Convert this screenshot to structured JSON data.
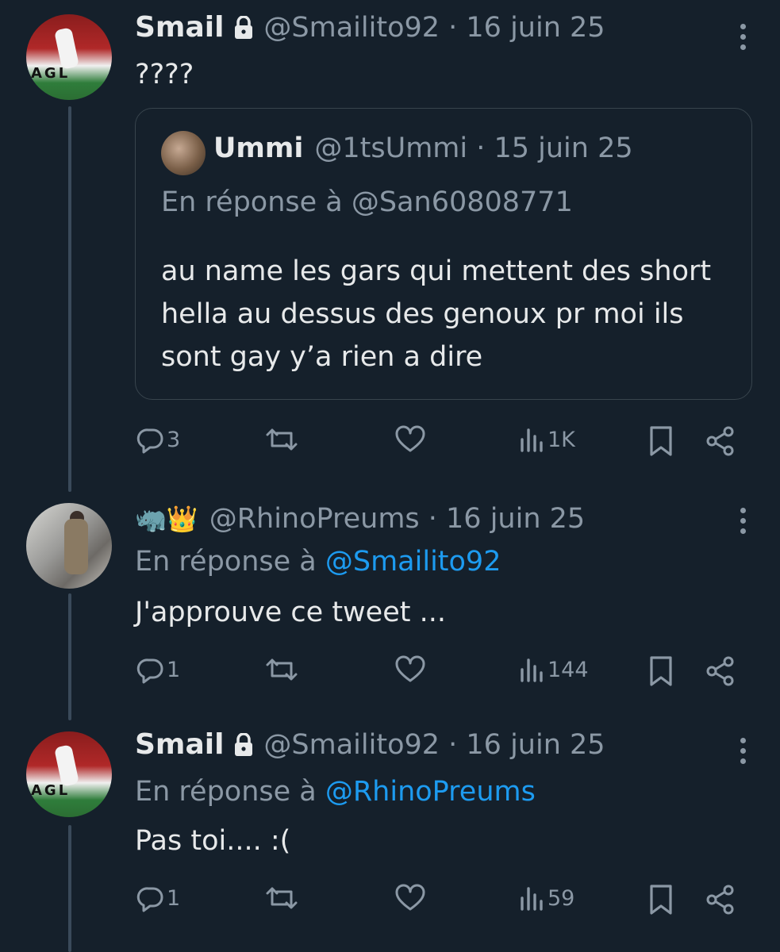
{
  "tweets": [
    {
      "author_name": "Smail",
      "handle_date": "@Smailito92 · 16 juin 25",
      "text": "????",
      "quote": {
        "author_name": "Ummi",
        "handle_date": "@1tsUmmi · 15 juin 25",
        "reply_to": "En réponse à @San60808771",
        "text": "au name les gars qui mettent des short hella au dessus des genoux pr moi ils sont gay y’a rien a dire"
      },
      "stats": {
        "replies": "3",
        "retweets": "",
        "likes": "",
        "views": "1K"
      }
    },
    {
      "author_name": "🦏👑",
      "handle_date": "@RhinoPreums · 16 juin 25",
      "reply_prefix": "En réponse à ",
      "reply_mention": "@Smailito92",
      "text": "J'approuve ce tweet ...",
      "stats": {
        "replies": "1",
        "retweets": "",
        "likes": "",
        "views": "144"
      }
    },
    {
      "author_name": "Smail",
      "handle_date": "@Smailito92 · 16 juin 25",
      "reply_prefix": "En réponse à ",
      "reply_mention": "@RhinoPreums",
      "text": "Pas toi.... :(",
      "stats": {
        "replies": "1",
        "retweets": "",
        "likes": "",
        "views": "59"
      }
    }
  ],
  "avatar_text": "AGL",
  "icons": [
    "lock-icon",
    "more-icon",
    "reply-icon",
    "retweet-icon",
    "like-icon",
    "views-icon",
    "bookmark-icon",
    "share-icon"
  ],
  "colors": {
    "background": "#15202b",
    "text": "#e7e9ea",
    "secondary": "#8b98a5",
    "link": "#1d9bf0",
    "border": "#38444d"
  }
}
